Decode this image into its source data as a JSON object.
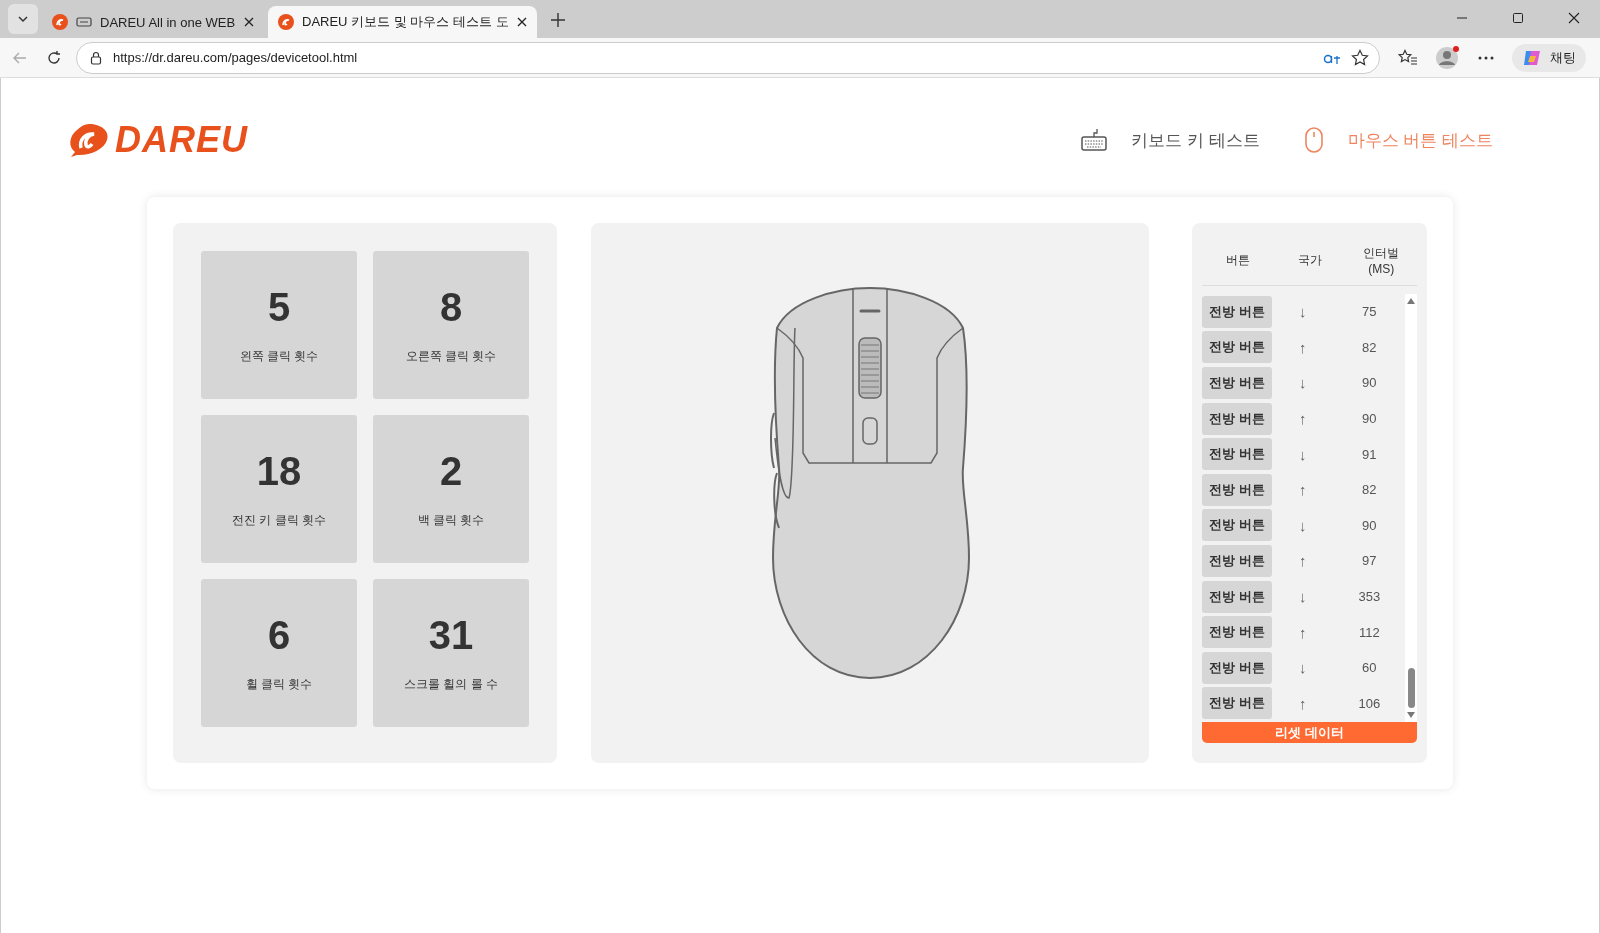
{
  "browser": {
    "tabs": [
      {
        "title": "DAREU All in one WEB",
        "selected": false
      },
      {
        "title": "DAREU 키보드 및 마우스 테스트 도",
        "selected": true
      }
    ],
    "url": "https://dr.dareu.com/pages/devicetool.html",
    "chat_label": "채팅"
  },
  "header": {
    "logo": "DAREU",
    "nav": [
      {
        "label": "키보드 키 테스트",
        "kind": "keyboard",
        "selected": false
      },
      {
        "label": "마우스 버튼 테스트",
        "kind": "mouse",
        "selected": true
      }
    ]
  },
  "stats": [
    {
      "value": "5",
      "label": "왼쪽 클릭 횟수"
    },
    {
      "value": "8",
      "label": "오른쪽 클릭 횟수"
    },
    {
      "value": "18",
      "label": "전진 키 클릭 횟수"
    },
    {
      "value": "2",
      "label": "백 클릭 횟수"
    },
    {
      "value": "6",
      "label": "휠 클릭 횟수"
    },
    {
      "value": "31",
      "label": "스크롤 휠의 롤 수"
    }
  ],
  "log": {
    "columns": [
      "버튼",
      "국가",
      "인터벌\n(MS)"
    ],
    "rows": [
      {
        "button": "전방 버튼",
        "state": "↓",
        "interval": "75"
      },
      {
        "button": "전방 버튼",
        "state": "↑",
        "interval": "82"
      },
      {
        "button": "전방 버튼",
        "state": "↓",
        "interval": "90"
      },
      {
        "button": "전방 버튼",
        "state": "↑",
        "interval": "90"
      },
      {
        "button": "전방 버튼",
        "state": "↓",
        "interval": "91"
      },
      {
        "button": "전방 버튼",
        "state": "↑",
        "interval": "82"
      },
      {
        "button": "전방 버튼",
        "state": "↓",
        "interval": "90"
      },
      {
        "button": "전방 버튼",
        "state": "↑",
        "interval": "97"
      },
      {
        "button": "전방 버튼",
        "state": "↓",
        "interval": "353"
      },
      {
        "button": "전방 버튼",
        "state": "↑",
        "interval": "112"
      },
      {
        "button": "전방 버튼",
        "state": "↓",
        "interval": "60"
      },
      {
        "button": "전방 버튼",
        "state": "↑",
        "interval": "106"
      }
    ],
    "reset_button": "리셋 데이터"
  }
}
